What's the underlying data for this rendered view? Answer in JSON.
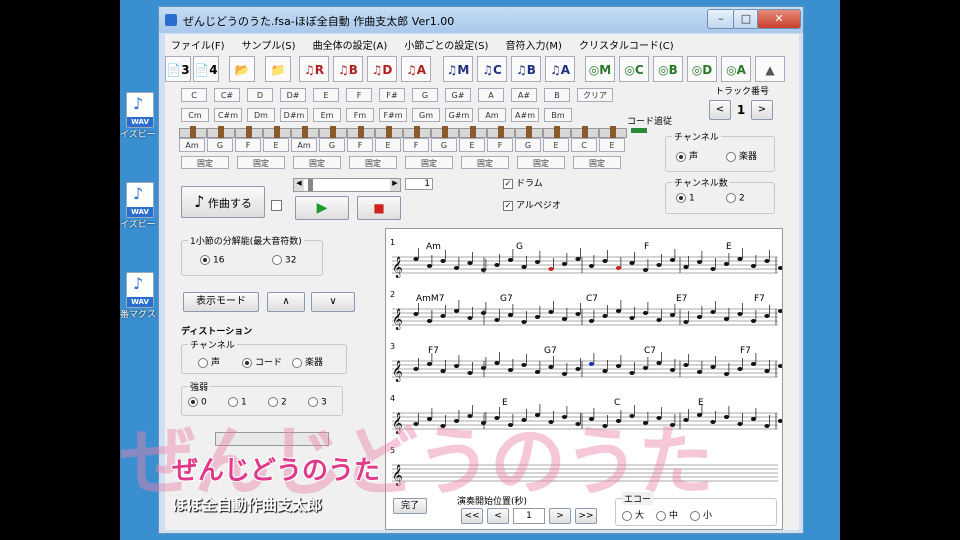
{
  "window": {
    "title": "ぜんじどうのうた.fsa-ほぼ全自動 作曲支太郎 Ver1.00"
  },
  "desktop_icons": [
    {
      "label": "イズビー",
      "badge": "WAV"
    },
    {
      "label": "イズビー",
      "badge": "WAV"
    },
    {
      "label": "番マグス",
      "badge": "WAV"
    }
  ],
  "menu": [
    "ファイル(F)",
    "サンプル(S)",
    "曲全体の設定(A)",
    "小節ごとの設定(S)",
    "音符入力(M)",
    "クリスタルコード(C)"
  ],
  "toolbar": {
    "time_sigs": [
      "3",
      "4"
    ],
    "chord_buttons": [
      "R",
      "B",
      "D",
      "A",
      "M",
      "C",
      "B",
      "A"
    ],
    "circle_buttons": [
      "M",
      "C",
      "B",
      "D",
      "A"
    ]
  },
  "chord_row1": [
    "C",
    "C#",
    "D",
    "D#",
    "E",
    "F",
    "F#",
    "G",
    "G#",
    "A",
    "A#",
    "B",
    "クリア"
  ],
  "chord_row2": [
    "Cm",
    "C#m",
    "Dm",
    "D#m",
    "Em",
    "Fm",
    "F#m",
    "Gm",
    "G#m",
    "Am",
    "A#m",
    "Bm"
  ],
  "note_row": [
    "Am",
    "G",
    "F",
    "E",
    "Am",
    "G",
    "F",
    "E",
    "F",
    "G",
    "E",
    "F",
    "G",
    "E",
    "C",
    "E"
  ],
  "fix_label": "固定",
  "code_tracking_label": "コード追従",
  "track": {
    "label": "トラック番号",
    "prev": "<",
    "value": "1",
    "next": ">"
  },
  "channel_group": {
    "title": "チャンネル",
    "options": [
      "声",
      "楽器"
    ]
  },
  "channel_num_group": {
    "title": "チャンネル数",
    "options": [
      "1",
      "2"
    ]
  },
  "compose_button": "作曲する",
  "position_value": "1",
  "drum_label": "ドラム",
  "alpeggio_label": "アルペジオ",
  "min_note_group": {
    "title": "1小節の分解能(最大音符数)",
    "options": [
      "16",
      "32"
    ]
  },
  "display_mode_button": "表示モード",
  "up_button": "∧",
  "down_button": "∨",
  "distortion": {
    "label": "ディストーション",
    "group_title": "チャンネル",
    "options": [
      "声",
      "コード",
      "楽器"
    ]
  },
  "strength": {
    "title": "強弱",
    "options": [
      "0",
      "1",
      "2",
      "3"
    ]
  },
  "score": {
    "rows": [
      {
        "num": "1",
        "chords": [
          "Am",
          "G",
          "F",
          "E"
        ]
      },
      {
        "num": "2",
        "chords": [
          "AmM7",
          "G7",
          "C7",
          "E7",
          "F7"
        ]
      },
      {
        "num": "3",
        "chords": [
          "F7",
          "G7",
          "C7",
          "F7"
        ]
      },
      {
        "num": "4",
        "chords": [
          "E",
          "C",
          "E"
        ]
      },
      {
        "num": "5",
        "chords": []
      }
    ]
  },
  "playback": {
    "label": "演奏開始位置(秒)",
    "buttons": [
      "<<",
      "<",
      "1",
      ">",
      ">>"
    ],
    "stop_label": "完了"
  },
  "echo": {
    "title": "エコー",
    "options": [
      "大",
      "中",
      "小"
    ]
  },
  "overlay": {
    "big_text": "ぜんじどうのうた",
    "title": "ぜんじどうのうた",
    "subtitle": "ほぼ全自動作曲支太郎"
  }
}
